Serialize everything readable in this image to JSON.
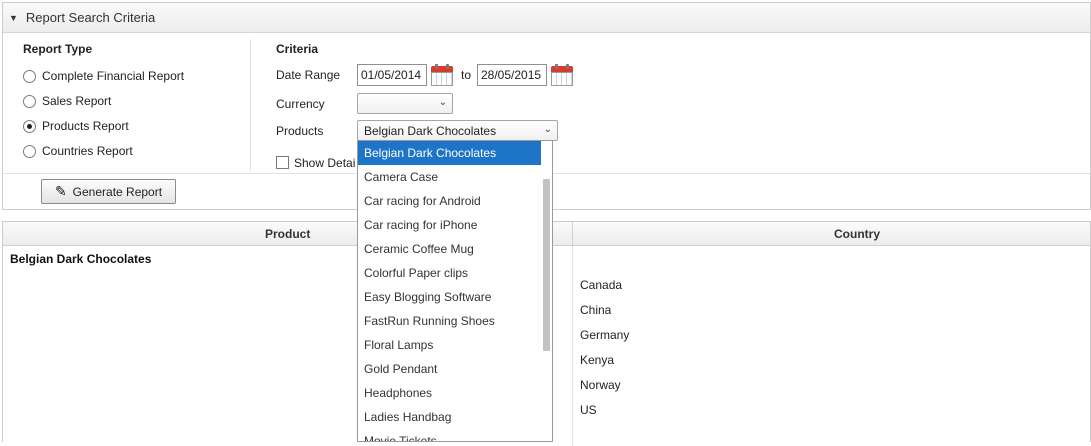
{
  "panel": {
    "title": "Report Search Criteria"
  },
  "report_type": {
    "label": "Report Type",
    "options": [
      {
        "label": "Complete Financial Report",
        "checked": false
      },
      {
        "label": "Sales Report",
        "checked": false
      },
      {
        "label": "Products Report",
        "checked": true
      },
      {
        "label": "Countries Report",
        "checked": false
      }
    ]
  },
  "criteria": {
    "label": "Criteria",
    "date_range_label": "Date Range",
    "date_from": "01/05/2014",
    "to_label": "to",
    "date_to": "28/05/2015",
    "currency_label": "Currency",
    "currency_value": "",
    "products_label": "Products",
    "products_value": "Belgian Dark Chocolates",
    "show_details_label": "Show Detai"
  },
  "generate_button": {
    "label": "Generate Report"
  },
  "table": {
    "columns": [
      "Product",
      "Country"
    ],
    "product": "Belgian Dark Chocolates",
    "countries": [
      "Canada",
      "China",
      "Germany",
      "Kenya",
      "Norway",
      "US"
    ]
  },
  "dropdown": {
    "items": [
      "Belgian Dark Chocolates",
      "Camera Case",
      "Car racing for Android",
      "Car racing for iPhone",
      "Ceramic Coffee Mug",
      "Colorful Paper clips",
      "Easy Blogging Software",
      "FastRun Running Shoes",
      "Floral Lamps",
      "Gold Pendant",
      "Headphones",
      "Ladies Handbag",
      "Movie Tickets"
    ],
    "selected_index": 0
  },
  "colors": {
    "selection": "#1e74c7",
    "calendar_red": "#d93a2b"
  }
}
